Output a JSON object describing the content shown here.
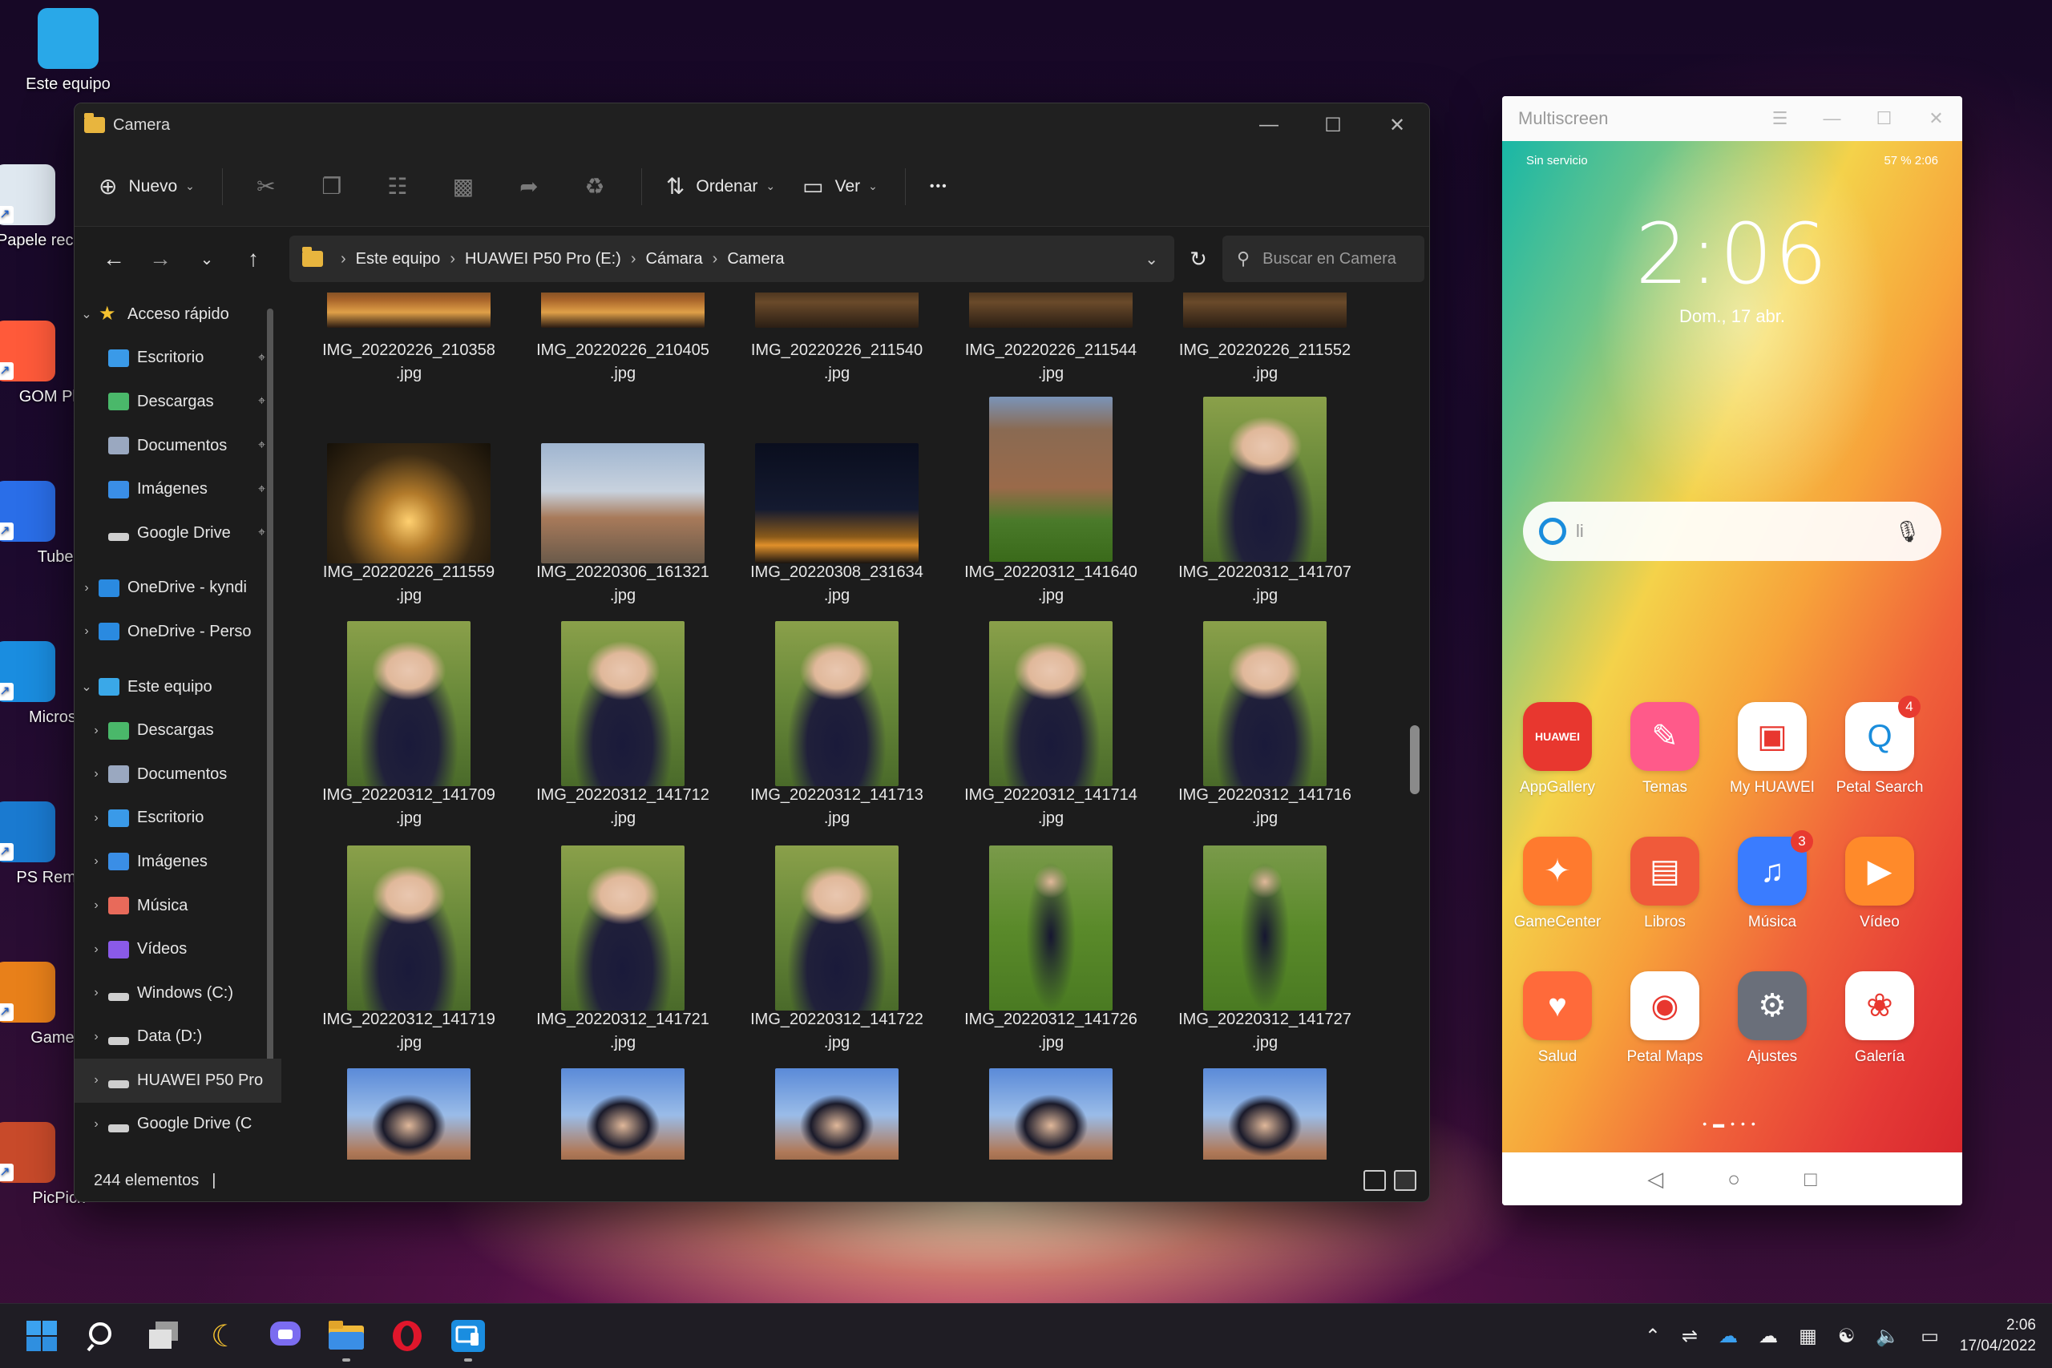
{
  "desktop": {
    "icons": [
      {
        "label": "Este equipo",
        "name": "this-pc-icon"
      },
      {
        "label": "Papele recic",
        "name": "recycle-bin-icon"
      },
      {
        "label": "GOM Pla",
        "name": "gom-player-icon"
      },
      {
        "label": "TubeD",
        "name": "tubedigger-icon"
      },
      {
        "label": "Microso",
        "name": "microsoft-edge-icon"
      },
      {
        "label": "PS Remo",
        "name": "ps-remote-play-icon"
      },
      {
        "label": "GameE",
        "name": "game-booster-icon"
      },
      {
        "label": "PicPick",
        "name": "picpick-icon"
      }
    ]
  },
  "explorer": {
    "title": "Camera",
    "toolbar": {
      "new_label": "Nuevo",
      "sort_label": "Ordenar",
      "view_label": "Ver",
      "more_label": "•••"
    },
    "address": {
      "crumbs": [
        "Este equipo",
        "HUAWEI P50 Pro (E:)",
        "Cámara",
        "Camera"
      ]
    },
    "search_placeholder": "Buscar en Camera",
    "sidebar": [
      {
        "label": "Acceso rápido",
        "expander": "v",
        "indent": 0,
        "icon": "star",
        "pin": false
      },
      {
        "label": "Escritorio",
        "expander": "",
        "indent": 1,
        "icon": "desktop",
        "pin": true
      },
      {
        "label": "Descargas",
        "expander": "",
        "indent": 1,
        "icon": "download",
        "pin": true
      },
      {
        "label": "Documentos",
        "expander": "",
        "indent": 1,
        "icon": "documents",
        "pin": true
      },
      {
        "label": "Imágenes",
        "expander": "",
        "indent": 1,
        "icon": "pictures",
        "pin": true
      },
      {
        "label": "Google Drive",
        "expander": "",
        "indent": 1,
        "icon": "drive",
        "pin": true
      },
      {
        "label": "OneDrive - kyndi",
        "expander": ">",
        "indent": 0,
        "icon": "onedrive",
        "pin": false
      },
      {
        "label": "OneDrive - Perso",
        "expander": ">",
        "indent": 0,
        "icon": "onedrive",
        "pin": false
      },
      {
        "label": "Este equipo",
        "expander": "v",
        "indent": 0,
        "icon": "pc",
        "pin": false
      },
      {
        "label": "Descargas",
        "expander": ">",
        "indent": 1,
        "icon": "download",
        "pin": false
      },
      {
        "label": "Documentos",
        "expander": ">",
        "indent": 1,
        "icon": "documents",
        "pin": false
      },
      {
        "label": "Escritorio",
        "expander": ">",
        "indent": 1,
        "icon": "desktop",
        "pin": false
      },
      {
        "label": "Imágenes",
        "expander": ">",
        "indent": 1,
        "icon": "pictures",
        "pin": false
      },
      {
        "label": "Música",
        "expander": ">",
        "indent": 1,
        "icon": "music",
        "pin": false
      },
      {
        "label": "Vídeos",
        "expander": ">",
        "indent": 1,
        "icon": "videos",
        "pin": false
      },
      {
        "label": "Windows (C:)",
        "expander": ">",
        "indent": 1,
        "icon": "drive",
        "pin": false
      },
      {
        "label": "Data (D:)",
        "expander": ">",
        "indent": 1,
        "icon": "drive",
        "pin": false
      },
      {
        "label": "HUAWEI P50 Pro",
        "expander": ">",
        "indent": 1,
        "icon": "drive",
        "pin": false,
        "selected": true
      },
      {
        "label": "Google Drive (C",
        "expander": ">",
        "indent": 1,
        "icon": "drive",
        "pin": false
      }
    ],
    "files": [
      {
        "name": "IMG_20220226_210358",
        "ext": ".jpg",
        "kind": "land",
        "palette": "night-warm"
      },
      {
        "name": "IMG_20220226_210405",
        "ext": ".jpg",
        "kind": "land",
        "palette": "night-warm"
      },
      {
        "name": "IMG_20220226_211540",
        "ext": ".jpg",
        "kind": "land",
        "palette": "night-dark"
      },
      {
        "name": "IMG_20220226_211544",
        "ext": ".jpg",
        "kind": "land",
        "palette": "night-dark"
      },
      {
        "name": "IMG_20220226_211552",
        "ext": ".jpg",
        "kind": "land",
        "palette": "night-dark"
      },
      {
        "name": "IMG_20220226_211559",
        "ext": ".jpg",
        "kind": "land",
        "palette": "candle"
      },
      {
        "name": "IMG_20220306_161321",
        "ext": ".jpg",
        "kind": "land",
        "palette": "city-day"
      },
      {
        "name": "IMG_20220308_231634",
        "ext": ".jpg",
        "kind": "land",
        "palette": "city-night"
      },
      {
        "name": "IMG_20220312_141640",
        "ext": ".jpg",
        "kind": "port",
        "palette": "wall"
      },
      {
        "name": "IMG_20220312_141707",
        "ext": ".jpg",
        "kind": "port",
        "palette": "portrait"
      },
      {
        "name": "IMG_20220312_141709",
        "ext": ".jpg",
        "kind": "port",
        "palette": "portrait"
      },
      {
        "name": "IMG_20220312_141712",
        "ext": ".jpg",
        "kind": "port",
        "palette": "portrait"
      },
      {
        "name": "IMG_20220312_141713",
        "ext": ".jpg",
        "kind": "port",
        "palette": "portrait"
      },
      {
        "name": "IMG_20220312_141714",
        "ext": ".jpg",
        "kind": "port",
        "palette": "portrait"
      },
      {
        "name": "IMG_20220312_141716",
        "ext": ".jpg",
        "kind": "port",
        "palette": "portrait"
      },
      {
        "name": "IMG_20220312_141719",
        "ext": ".jpg",
        "kind": "port",
        "palette": "portrait"
      },
      {
        "name": "IMG_20220312_141721",
        "ext": ".jpg",
        "kind": "port",
        "palette": "portrait"
      },
      {
        "name": "IMG_20220312_141722",
        "ext": ".jpg",
        "kind": "port",
        "palette": "portrait"
      },
      {
        "name": "IMG_20220312_141726",
        "ext": ".jpg",
        "kind": "port",
        "palette": "portrait-full"
      },
      {
        "name": "IMG_20220312_141727",
        "ext": ".jpg",
        "kind": "port",
        "palette": "portrait-full"
      },
      {
        "name": "",
        "ext": "",
        "kind": "port",
        "palette": "portrait-sky"
      },
      {
        "name": "",
        "ext": "",
        "kind": "port",
        "palette": "portrait-sky"
      },
      {
        "name": "",
        "ext": "",
        "kind": "port",
        "palette": "portrait-sky"
      },
      {
        "name": "",
        "ext": "",
        "kind": "port",
        "palette": "portrait-sky"
      },
      {
        "name": "",
        "ext": "",
        "kind": "port",
        "palette": "portrait-sky"
      }
    ],
    "status": "244 elementos",
    "status_cursor": "|"
  },
  "multiscreen": {
    "title": "Multiscreen",
    "status_left": "Sin servicio",
    "status_right": "57 %  2:06",
    "clock": "2:06",
    "date": "Dom., 17 abr.",
    "search_placeholder": "li",
    "apps": [
      {
        "label": "AppGallery",
        "name": "appgallery-icon",
        "bg": "#e8372f",
        "glyph": "HUAWEI",
        "badge": ""
      },
      {
        "label": "Temas",
        "name": "themes-icon",
        "bg": "#ff5a8a",
        "glyph": "✎",
        "badge": ""
      },
      {
        "label": "My HUAWEI",
        "name": "my-huawei-icon",
        "bg": "#ffffff",
        "glyph": "▣",
        "badge": ""
      },
      {
        "label": "Petal Search",
        "name": "petal-search-icon",
        "bg": "#ffffff",
        "glyph": "Q",
        "badge": "4"
      },
      {
        "label": "GameCenter",
        "name": "gamecenter-icon",
        "bg": "#ff7a2e",
        "glyph": "✦",
        "badge": ""
      },
      {
        "label": "Libros",
        "name": "books-icon",
        "bg": "#f05a3a",
        "glyph": "▤",
        "badge": ""
      },
      {
        "label": "Música",
        "name": "music-icon",
        "bg": "#3a7cff",
        "glyph": "♫",
        "badge": "3"
      },
      {
        "label": "Vídeo",
        "name": "video-icon",
        "bg": "#ff8a2a",
        "glyph": "▶",
        "badge": ""
      },
      {
        "label": "Salud",
        "name": "health-icon",
        "bg": "#ff6a3a",
        "glyph": "♥",
        "badge": ""
      },
      {
        "label": "Petal Maps",
        "name": "petal-maps-icon",
        "bg": "#ffffff",
        "glyph": "◉",
        "badge": ""
      },
      {
        "label": "Ajustes",
        "name": "settings-icon",
        "bg": "#6a6f7a",
        "glyph": "⚙",
        "badge": ""
      },
      {
        "label": "Galería",
        "name": "gallery-icon",
        "bg": "#ffffff",
        "glyph": "❀",
        "badge": ""
      }
    ],
    "dock": [
      {
        "name": "phone-icon",
        "bg": "#1fbf4a",
        "glyph": "☎"
      },
      {
        "name": "messages-icon",
        "bg": "#2f9ff0",
        "glyph": "▬"
      },
      {
        "name": "browser-icon",
        "bg": "#ffffff",
        "glyph": "◎"
      },
      {
        "name": "camera-icon",
        "bg": "#ffffff",
        "glyph": "■"
      }
    ]
  },
  "taskbar": {
    "time": "2:06",
    "date": "17/04/2022"
  },
  "colors": {
    "accent": "#0078d4",
    "explorer_bg": "#1c1c1c",
    "toolbar_bg": "#202020"
  }
}
